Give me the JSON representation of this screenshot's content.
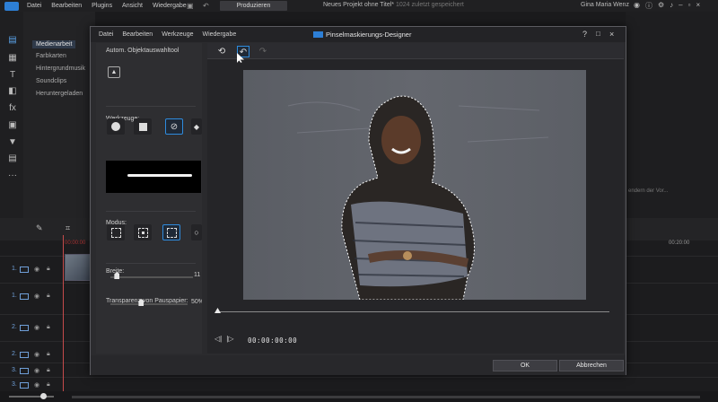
{
  "app": {
    "menu": [
      "Datei",
      "Bearbeiten",
      "Plugins",
      "Ansicht",
      "Wiedergabe"
    ],
    "produce_button": "Produzieren",
    "project_title": "Neues Projekt ohne Titel*",
    "project_suffix": "1024 zuletzt gespeichert",
    "user_name": "Gina Maria Wenz",
    "title_icons": [
      "user-icon",
      "info-icon",
      "gear-icon",
      "bell-icon",
      "minimize-icon",
      "restore-icon",
      "close-icon"
    ]
  },
  "media_panel": {
    "items": [
      {
        "label": "Medienarbeit",
        "active": true
      },
      {
        "label": "Farbkarten",
        "active": false
      },
      {
        "label": "Hintergrundmusik",
        "active": false
      },
      {
        "label": "Soundclips",
        "active": false
      },
      {
        "label": "Heruntergeladen",
        "active": false
      }
    ]
  },
  "right_panel": {
    "preview_text": "endern der Vor..."
  },
  "timeline": {
    "time_left": "00:00:00",
    "time_right": "00:20:00",
    "tracks": [
      {
        "label": "1."
      },
      {
        "label": "1."
      },
      {
        "label": "2."
      },
      {
        "label": "2."
      },
      {
        "label": "3."
      },
      {
        "label": "3."
      }
    ]
  },
  "dialog": {
    "title": "Pinselmaskierungs-Designer",
    "menu": [
      "Datei",
      "Bearbeiten",
      "Werkzeuge",
      "Wiedergabe"
    ],
    "help": "?",
    "tools": {
      "auto_tool_label": "Autom. Objektauswahltool",
      "tools_label": "Werkzeuge:",
      "mode_label": "Modus:",
      "width_label": "Breite:",
      "width_value": "11",
      "tracing_label": "Transparenz von Pauspapier:",
      "tracing_value": "50%",
      "width_level": 0.08,
      "tracing_level": 0.4
    },
    "timecode": "00:00:00:00",
    "ok_button": "OK",
    "cancel_button": "Abbrechen"
  },
  "colors": {
    "accent": "#2e8bdd",
    "brand": "#2d7fd6",
    "playhead": "#c64b4b"
  }
}
